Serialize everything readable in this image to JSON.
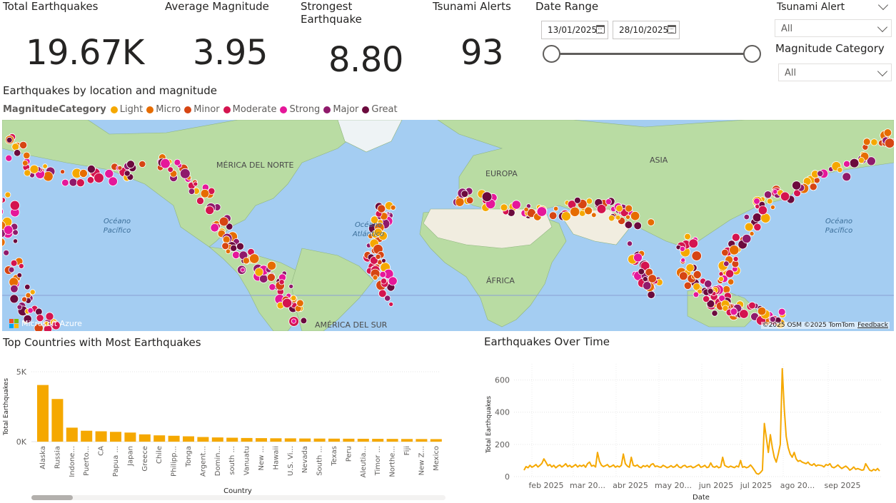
{
  "kpis": [
    {
      "title": "Total Earthquakes",
      "value": "19.67K"
    },
    {
      "title": "Average Magnitude",
      "value": "3.95"
    },
    {
      "title": "Strongest Earthquake",
      "value": "8.80"
    },
    {
      "title": "Tsunami Alerts",
      "value": "93"
    }
  ],
  "date_range": {
    "title": "Date Range",
    "start": "13/01/2025",
    "end": "28/10/2025"
  },
  "tsunami_slicer": {
    "title": "Tsunami Alert",
    "value": "All"
  },
  "magnitude_slicer": {
    "title": "Magnitude Category",
    "value": "All"
  },
  "map": {
    "title": "Earthquakes by location and magnitude",
    "legend_title": "MagnitudeCategory",
    "legend": [
      {
        "label": "Light",
        "color": "#f5a800"
      },
      {
        "label": "Micro",
        "color": "#e66c00"
      },
      {
        "label": "Minor",
        "color": "#d64513"
      },
      {
        "label": "Moderate",
        "color": "#d4144f"
      },
      {
        "label": "Strong",
        "color": "#e5179a"
      },
      {
        "label": "Major",
        "color": "#8f1a6b"
      },
      {
        "label": "Great",
        "color": "#6b0a3d"
      }
    ],
    "labels": {
      "north_america": "MÉRICA DEL NORTE",
      "europe": "EUROPA",
      "asia": "ASIA",
      "africa": "ÁFRICA",
      "south_america": "AMÉRICA DEL SUR",
      "pacific_left": "Océano Pacífico",
      "atlantic": "Océano Atlántico",
      "pacific_right": "Océano Pacífico"
    },
    "brand": "Microsoft Azure",
    "copyright": "©2025 OSM ©2025 TomTom",
    "feedback": "Feedback"
  },
  "bar_section": {
    "title": "Top Countries with Most Earthquakes"
  },
  "line_section": {
    "title": "Earthquakes Over Time"
  },
  "chart_data": [
    {
      "type": "bar",
      "title": "Top Countries with Most Earthquakes",
      "xlabel": "Country",
      "ylabel": "Total Earthquakes",
      "yticks": [
        "0K",
        "5K"
      ],
      "ylim": [
        0,
        5000
      ],
      "color": "#f5a800",
      "categories": [
        "Alaska",
        "Russia",
        "Indone...",
        "Puerto...",
        "CA",
        "Papua ...",
        "Japan",
        "Greece",
        "Chile",
        "Philipp...",
        "Tonga",
        "Argent...",
        "Domin...",
        "south ...",
        "Vanuatu",
        "New ...",
        "Hawaii",
        "U.S. Vi...",
        "Nevada",
        "South ...",
        "Texas",
        "Peru",
        "Aleutia...",
        "Timor ...",
        "Northe...",
        "Fiji",
        "New Z...",
        "Mexico"
      ],
      "values": [
        4050,
        3050,
        1000,
        780,
        740,
        700,
        650,
        520,
        450,
        420,
        380,
        330,
        300,
        280,
        260,
        250,
        240,
        235,
        225,
        220,
        215,
        210,
        205,
        200,
        195,
        190,
        185,
        180
      ]
    },
    {
      "type": "line",
      "title": "Earthquakes Over Time",
      "xlabel": "Date",
      "ylabel": "Total Earthquakes",
      "ylim": [
        0,
        700
      ],
      "yticks": [
        0,
        200,
        400,
        600
      ],
      "xticks": [
        "feb 2025",
        "mar 20...",
        "abr 2025",
        "may 20...",
        "jun 2025",
        "jul 2025",
        "ago 20...",
        "sep 2025"
      ],
      "color": "#f5a800",
      "x_start": "13/01/2025",
      "x_end": "28/10/2025",
      "values": [
        40,
        62,
        55,
        70,
        58,
        65,
        75,
        60,
        70,
        82,
        110,
        90,
        68,
        75,
        60,
        70,
        55,
        65,
        72,
        60,
        68,
        80,
        62,
        70,
        58,
        66,
        75,
        60,
        70,
        64,
        72,
        58,
        80,
        90,
        65,
        70,
        60,
        150,
        95,
        70,
        62,
        68,
        75,
        60,
        64,
        72,
        58,
        66,
        60,
        70,
        140,
        80,
        65,
        58,
        120,
        70,
        65,
        72,
        60,
        55,
        68,
        62,
        70,
        58,
        75,
        80,
        62,
        66,
        60,
        58,
        70,
        64,
        55,
        60,
        68,
        58,
        62,
        75,
        60,
        55,
        66,
        70,
        58,
        62,
        65,
        55,
        60,
        68,
        75,
        58,
        62,
        70,
        56,
        60,
        85,
        62,
        58,
        66,
        55,
        60,
        120,
        70,
        62,
        58,
        65,
        60,
        56,
        66,
        60,
        100,
        58,
        62,
        55,
        60,
        72,
        58,
        40,
        20,
        15,
        25,
        40,
        330,
        240,
        150,
        260,
        180,
        120,
        90,
        140,
        200,
        670,
        420,
        250,
        180,
        140,
        120,
        150,
        110,
        95,
        100,
        90,
        85,
        80,
        90,
        75,
        70,
        80,
        65,
        72,
        70,
        68,
        60,
        75,
        70,
        80,
        60,
        55,
        62,
        72,
        60,
        50,
        58,
        65,
        55,
        40,
        48,
        60,
        45,
        50,
        45,
        40,
        42,
        80,
        60,
        40,
        35,
        45,
        38,
        50,
        35
      ]
    }
  ]
}
